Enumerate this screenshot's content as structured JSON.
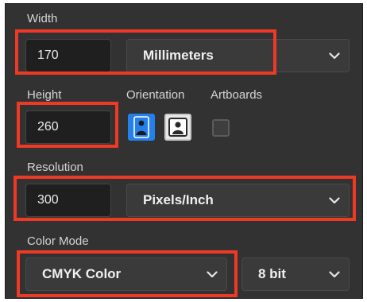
{
  "width": {
    "label": "Width",
    "value": "170",
    "unit": "Millimeters"
  },
  "height": {
    "label": "Height",
    "value": "260"
  },
  "orientation": {
    "label": "Orientation",
    "selected": "portrait",
    "portrait_icon": "portrait-person-icon",
    "landscape_icon": "landscape-person-icon"
  },
  "artboards": {
    "label": "Artboards",
    "checked": false
  },
  "resolution": {
    "label": "Resolution",
    "value": "300",
    "unit": "Pixels/Inch"
  },
  "color_mode": {
    "label": "Color Mode",
    "mode": "CMYK Color",
    "bit_depth": "8 bit"
  },
  "colors": {
    "panel_bg": "#323232",
    "highlight": "#ee3a24",
    "accent_blue": "#2680eb",
    "text": "#d6d6d6"
  }
}
